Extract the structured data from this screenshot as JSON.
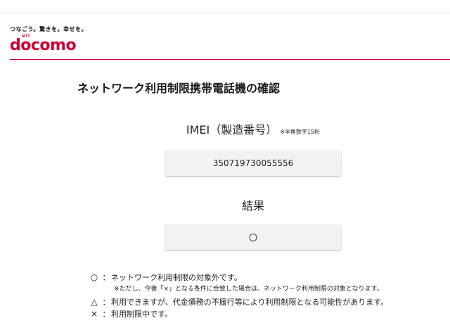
{
  "header": {
    "tagline": "つなごう。驚きを。幸せを。",
    "logo_small": "NTT",
    "logo_text": "docomo"
  },
  "page": {
    "title": "ネットワーク利用制限携帯電話機の確認"
  },
  "imei": {
    "label": "IMEI（製造番号）",
    "note": "※半角数字15桁",
    "value": "350719730055556"
  },
  "result": {
    "label": "結果",
    "value": "〇"
  },
  "legend": {
    "items": [
      {
        "symbol": "○",
        "text": "ネットワーク利用制限の対象外です。"
      },
      {
        "symbol": "△",
        "text": "利用できますが、代金債務の不履行等により利用制限となる可能性があります。"
      },
      {
        "symbol": "×",
        "text": "利用制限中です。"
      }
    ],
    "sub_note": "※ただし、今後「×」となる条件に合致した場合は、ネットワーク利用制限の対象となります。"
  },
  "colors": {
    "brand": "#cc0033",
    "field_bg": "#f2f2f2"
  }
}
